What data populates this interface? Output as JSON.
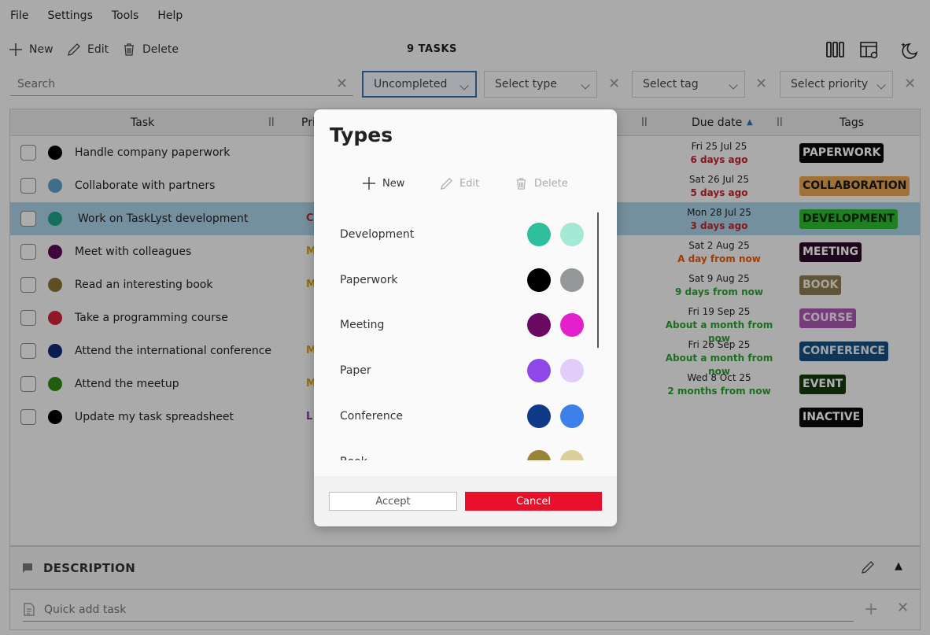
{
  "menu": [
    "File",
    "Settings",
    "Tools",
    "Help"
  ],
  "toolbar": {
    "new_label": "New",
    "edit_label": "Edit",
    "delete_label": "Delete",
    "task_count": "9 TASKS"
  },
  "filters": {
    "search_placeholder": "Search",
    "status": "Uncompleted",
    "type": "Select type",
    "tag": "Select tag",
    "priority": "Select priority"
  },
  "table": {
    "headers": {
      "task": "Task",
      "priority": "Pri",
      "due": "Due date",
      "tags": "Tags"
    },
    "rows": [
      {
        "name": "Handle company paperwork",
        "color": "#000000",
        "priority": "",
        "priority_color": "#e53030",
        "due_date": "Fri 25 Jul 25",
        "due_rel": "6 days ago",
        "rel_color": "#c0242a",
        "tag": "PAPERWORK",
        "tag_bg": "#0a0a0a",
        "tag_fg": "#ffffff",
        "selected": false
      },
      {
        "name": "Collaborate with partners",
        "color": "#5aa0c8",
        "priority": "",
        "priority_color": "#e53030",
        "due_date": "Sat 26 Jul 25",
        "due_rel": "5 days ago",
        "rel_color": "#c0242a",
        "tag": "COLLABORATION",
        "tag_bg": "#e8a650",
        "tag_fg": "#1a1a1a",
        "selected": false
      },
      {
        "name": "Work on TaskLyst development",
        "color": "#21a088",
        "priority": "C",
        "priority_color": "#b02a2a",
        "due_date": "Mon 28 Jul 25",
        "due_rel": "3 days ago",
        "rel_color": "#c0242a",
        "tag": "DEVELOPMENT",
        "tag_bg": "#2fb82f",
        "tag_fg": "#0d2a0d",
        "selected": true
      },
      {
        "name": "Meet with colleagues",
        "color": "#5a0a55",
        "priority": "M",
        "priority_color": "#d4a017",
        "due_date": "Sat 2 Aug 25",
        "due_rel": "A day from now",
        "rel_color": "#e05a12",
        "tag": "MEETING",
        "tag_bg": "#2c0a28",
        "tag_fg": "#ffffff",
        "selected": false
      },
      {
        "name": "Read an interesting book",
        "color": "#8a7232",
        "priority": "M",
        "priority_color": "#d4a017",
        "due_date": "Sat 9 Aug 25",
        "due_rel": "9 days from now",
        "rel_color": "#2e9e34",
        "tag": "BOOK",
        "tag_bg": "#8a7a55",
        "tag_fg": "#f0ecd8",
        "selected": false
      },
      {
        "name": "Take a programming course",
        "color": "#d4203a",
        "priority": "",
        "priority_color": "#e53030",
        "due_date": "Fri 19 Sep 25",
        "due_rel": "About a month from now",
        "rel_color": "#2e9e34",
        "tag": "COURSE",
        "tag_bg": "#a858b0",
        "tag_fg": "#f6e8f6",
        "selected": false
      },
      {
        "name": "Attend the international conference",
        "color": "#0e2a78",
        "priority": "M",
        "priority_color": "#d4a017",
        "due_date": "Fri 26 Sep 25",
        "due_rel": "About a month from now",
        "rel_color": "#2e9e34",
        "tag": "CONFERENCE",
        "tag_bg": "#1a4e7e",
        "tag_fg": "#e8f0f8",
        "selected": false
      },
      {
        "name": "Attend the meetup",
        "color": "#2e8a12",
        "priority": "M",
        "priority_color": "#d4a017",
        "due_date": "Wed 8 Oct 25",
        "due_rel": "2 months from now",
        "rel_color": "#2e9e34",
        "tag": "EVENT",
        "tag_bg": "#16380e",
        "tag_fg": "#ffffff",
        "selected": false
      },
      {
        "name": "Update my task spreadsheet",
        "color": "#000000",
        "priority": "L",
        "priority_color": "#7a3a9a",
        "due_date": "",
        "due_rel": "",
        "rel_color": "#2e9e34",
        "tag": "INACTIVE",
        "tag_bg": "#0a0a0a",
        "tag_fg": "#ffffff",
        "selected": false
      }
    ]
  },
  "description": {
    "title": "DESCRIPTION"
  },
  "quick_add": {
    "placeholder": "Quick add task"
  },
  "dialog": {
    "title": "Types",
    "new_label": "New",
    "edit_label": "Edit",
    "delete_label": "Delete",
    "types": [
      {
        "name": "Development",
        "color1": "#2ebf9c",
        "color2": "#a4e8d6"
      },
      {
        "name": "Paperwork",
        "color1": "#000000",
        "color2": "#959898"
      },
      {
        "name": "Meeting",
        "color1": "#6a0a62",
        "color2": "#e420cc"
      },
      {
        "name": "Paper",
        "color1": "#8e48e8",
        "color2": "#e2ccfa"
      },
      {
        "name": "Conference",
        "color1": "#0f3a88",
        "color2": "#3d80ea"
      },
      {
        "name": "Book",
        "color1": "#9a8238",
        "color2": "#dccf9a"
      }
    ],
    "accept_label": "Accept",
    "cancel_label": "Cancel"
  }
}
